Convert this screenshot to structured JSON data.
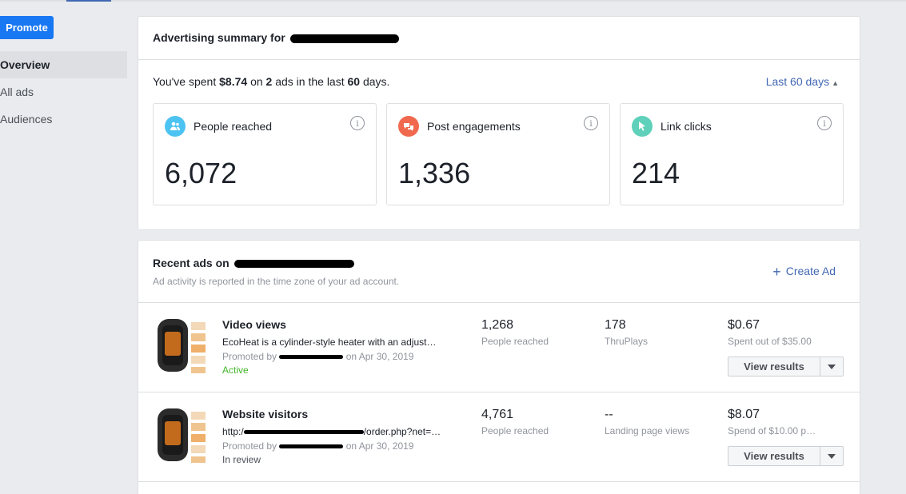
{
  "nav": {
    "promote_label": "Promote",
    "items": [
      {
        "label": "Overview",
        "active": true
      },
      {
        "label": "All ads",
        "active": false
      },
      {
        "label": "Audiences",
        "active": false
      }
    ]
  },
  "summary": {
    "title": "Advertising summary for",
    "spent_prefix": "You've spent",
    "spent_amount": "$8.74",
    "spent_on": "on",
    "ads_count": "2",
    "ads_word": "ads in the last",
    "days": "60",
    "days_word": "days.",
    "period_label": "Last 60 days",
    "metrics": [
      {
        "label": "People reached",
        "value": "6,072",
        "icon": "people-icon",
        "color": "#4dc3f1"
      },
      {
        "label": "Post engagements",
        "value": "1,336",
        "icon": "chat-bubble-icon",
        "color": "#f0694f"
      },
      {
        "label": "Link clicks",
        "value": "214",
        "icon": "cursor-icon",
        "color": "#5fd0b9"
      }
    ]
  },
  "recent": {
    "title": "Recent ads on",
    "subtitle": "Ad activity is reported in the time zone of your ad account.",
    "create_label": "Create Ad",
    "ads": [
      {
        "title": "Video views",
        "description": "EcoHeat is a cylinder-style heater with an adjust…",
        "promoted_prefix": "Promoted by",
        "promoted_date": "on Apr 30, 2019",
        "status": "Active",
        "status_color": "#42b72a",
        "reach_value": "1,268",
        "reach_label": "People reached",
        "metric_value": "178",
        "metric_label": "ThruPlays",
        "spend_value": "$0.67",
        "spend_label": "Spent out of $35.00",
        "view_label": "View results"
      },
      {
        "title": "Website visitors",
        "description": "http:/",
        "description_tail": "/order.php?net=…",
        "promoted_prefix": "Promoted by",
        "promoted_date": "on Apr 30, 2019",
        "status": "In review",
        "status_color": "#4b4f56",
        "reach_value": "4,761",
        "reach_label": "People reached",
        "metric_value": "--",
        "metric_label": "Landing page views",
        "spend_value": "$8.07",
        "spend_label": "Spend of $10.00 p…",
        "view_label": "View results"
      }
    ]
  }
}
